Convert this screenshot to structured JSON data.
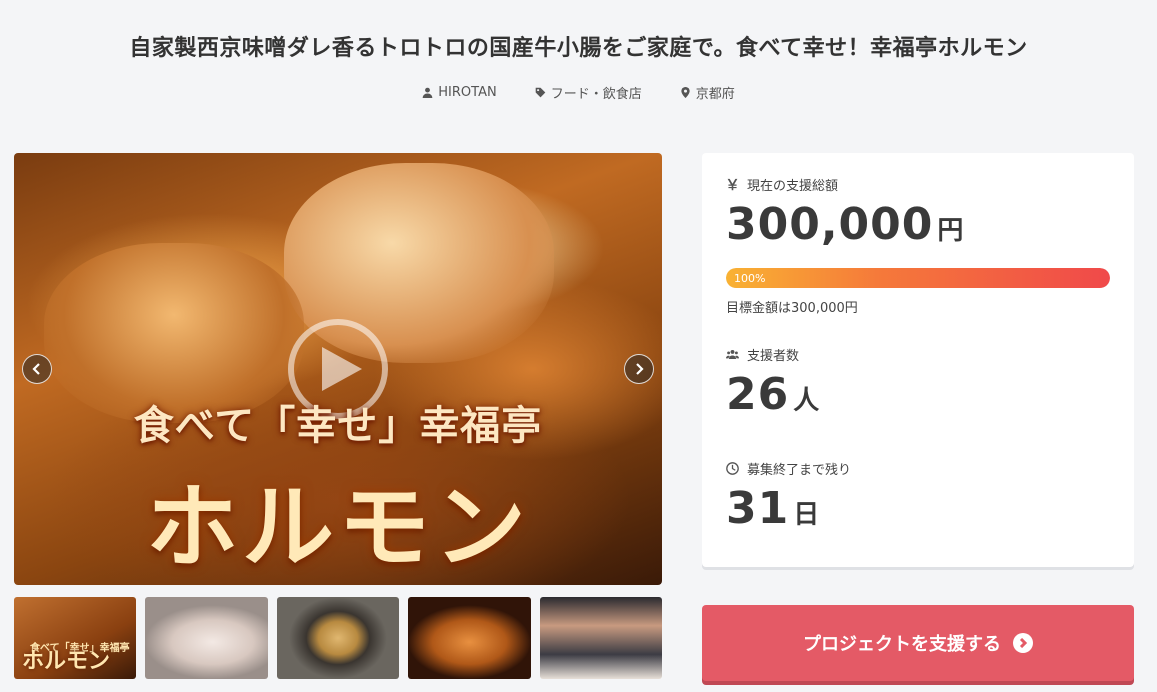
{
  "project": {
    "title": "自家製西京味噌ダレ香るトロトロの国産牛小腸をご家庭で。食べて幸せ！幸福亭ホルモン",
    "owner": "HIROTAN",
    "category": "フード・飲食店",
    "location": "京都府"
  },
  "hero": {
    "line1": "食べて「幸せ」幸福亭",
    "line2": "ホルモン"
  },
  "thumbnails": {
    "first_sub": "食べて「幸せ」幸福亭",
    "first_text": "ホルモン"
  },
  "stats": {
    "amount_label": "現在の支援総額",
    "amount_value": "300,000",
    "amount_unit": "円",
    "progress_label": "100%",
    "progress_fraction": 1.0,
    "goal_text": "目標金額は300,000円",
    "backers_label": "支援者数",
    "backers_value": "26",
    "backers_unit": "人",
    "remaining_label": "募集終了まで残り",
    "remaining_value": "31",
    "remaining_unit": "日"
  },
  "cta": {
    "support_label": "プロジェクトを支援する"
  },
  "colors": {
    "accent": "#e45a66",
    "progress_start": "#f9b233",
    "progress_end": "#f0494a"
  }
}
